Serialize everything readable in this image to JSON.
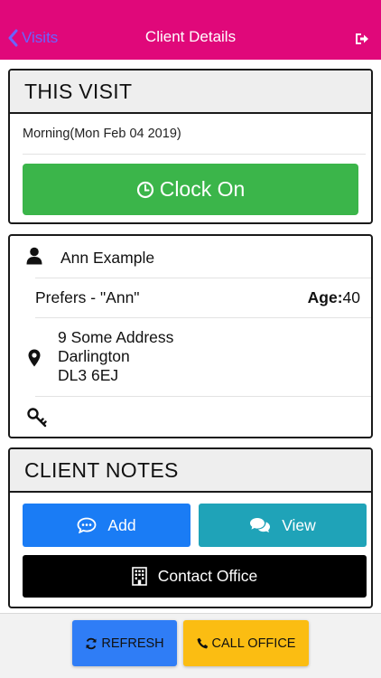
{
  "header": {
    "back_label": "Visits",
    "title": "Client Details",
    "logout_icon": "sign-out-icon",
    "background": "#e0087a",
    "back_color": "#6a63ff"
  },
  "this_visit": {
    "heading": "THIS VISIT",
    "visit_time": "Morning(Mon Feb 04 2019)",
    "clock_on_label": "Clock On",
    "clock_on_color": "#3bb54a",
    "clock_icon": "clock-icon"
  },
  "client": {
    "name": "Ann Example",
    "prefers": "Prefers - \"Ann\"",
    "age_label": "Age:",
    "age_value": "40",
    "address_line1": "9 Some Address",
    "address_line2": "Darlington",
    "address_line3": "DL3 6EJ",
    "icons": [
      "person-icon",
      "map-pin-icon",
      "key-icon"
    ]
  },
  "client_notes": {
    "heading": "CLIENT NOTES",
    "add_label": "Add",
    "view_label": "View",
    "contact_label": "Contact Office",
    "add_color": "#1a7cf5",
    "view_color": "#1fa3b8",
    "contact_color": "#000000"
  },
  "footer": {
    "refresh_label": "REFRESH",
    "call_office_label": "CALL OFFICE",
    "refresh_color": "#2f7df6",
    "call_color": "#fbbd12"
  }
}
